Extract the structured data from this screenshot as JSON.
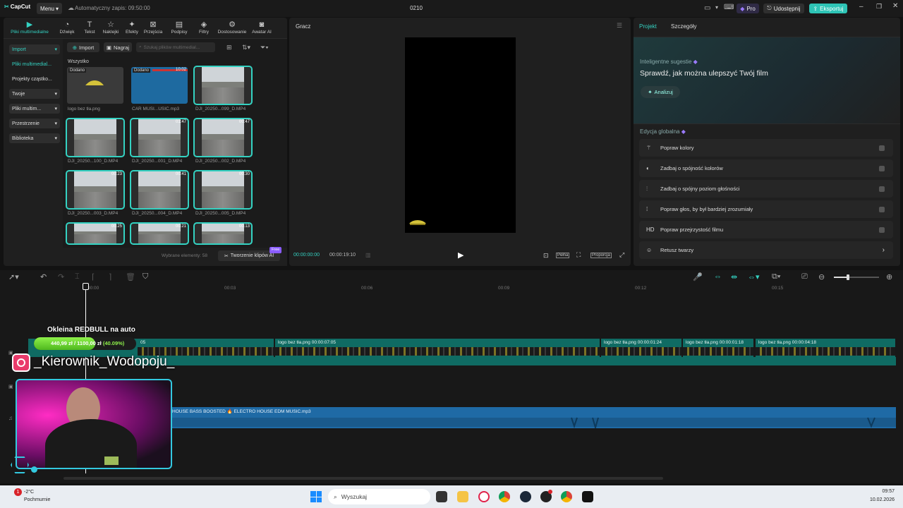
{
  "titlebar": {
    "app_name": "CapCut",
    "menu_label": "Menu",
    "autosave": "Automatyczny zapis: 09:50:00",
    "project_name": "0210",
    "pro_label": "Pro",
    "share_label": "Udostępnij",
    "export_label": "Eksportuj"
  },
  "toolbar": [
    {
      "label": "Pliki multimedialne",
      "icon": "media-icon"
    },
    {
      "label": "Dźwięk",
      "icon": "audio-icon"
    },
    {
      "label": "Tekst",
      "icon": "text-icon"
    },
    {
      "label": "Naklejki",
      "icon": "sticker-icon"
    },
    {
      "label": "Efekty",
      "icon": "effects-icon"
    },
    {
      "label": "Przejścia",
      "icon": "transition-icon"
    },
    {
      "label": "Podpisy",
      "icon": "captions-icon"
    },
    {
      "label": "Filtry",
      "icon": "filters-icon"
    },
    {
      "label": "Dostosowanie",
      "icon": "adjust-icon"
    },
    {
      "label": "Awatar AI",
      "icon": "avatar-icon"
    }
  ],
  "sidebar": [
    {
      "label": "Import"
    },
    {
      "label": "Pliki multimedial..."
    },
    {
      "label": "Projekty cząstko..."
    },
    {
      "label": "Twoje"
    },
    {
      "label": "Pliki multim..."
    },
    {
      "label": "Przestrzenie"
    },
    {
      "label": "Biblioteka"
    }
  ],
  "media": {
    "import_label": "Import",
    "record_label": "Nagraj",
    "search_placeholder": "Szukaj plików multimedial...",
    "all_label": "Wszystko",
    "added_badge": "Dodano",
    "items": [
      {
        "name": "logo bez tła.png",
        "dur": ""
      },
      {
        "name": "CAR MUSI...USIC.mp3",
        "dur": "10:02"
      },
      {
        "name": "DJI_20250...099_D.MP4",
        "dur": ""
      },
      {
        "name": "DJI_20250...100_D.MP4",
        "dur": ""
      },
      {
        "name": "DJI_20250...001_D.MP4",
        "dur": "01:47"
      },
      {
        "name": "DJI_20250...002_D.MP4",
        "dur": "00:47"
      },
      {
        "name": "DJI_20250...003_D.MP4",
        "dur": "00:23"
      },
      {
        "name": "DJI_20250...004_D.MP4",
        "dur": "00:41"
      },
      {
        "name": "DJI_20250...005_D.MP4",
        "dur": "00:30"
      },
      {
        "name": "",
        "dur": "00:25"
      },
      {
        "name": "",
        "dur": "00:21"
      },
      {
        "name": "",
        "dur": "00:13"
      }
    ],
    "selected_count": "Wybrane elementy: 58",
    "ai_clips_label": "Tworzenie klipów AI",
    "free_badge": "Free"
  },
  "player": {
    "title": "Gracz",
    "time_current": "00:00:00:00",
    "time_total": "00:00:19:10",
    "full_label": "Pełna",
    "ratio_label": "Proporcja"
  },
  "right": {
    "tab_project": "Projekt",
    "tab_details": "Szczegóły",
    "suggest_title": "Inteligentne sugestie",
    "suggest_heading": "Sprawdź, jak można ulepszyć Twój film",
    "analyze_label": "Analizuj",
    "global_title": "Edycja globalna",
    "rows": [
      {
        "label": "Popraw kolory",
        "icon": "wand-icon"
      },
      {
        "label": "Zadbaj o spójność kolorów",
        "icon": "color-match-icon"
      },
      {
        "label": "Zadbaj o spójny poziom głośności",
        "icon": "volume-levels-icon"
      },
      {
        "label": "Popraw głos, by był bardziej zrozumiały",
        "icon": "voice-icon"
      },
      {
        "label": "Popraw przejrzystość filmu",
        "icon": "hd-icon"
      },
      {
        "label": "Retusz twarzy",
        "icon": "face-retouch-icon"
      }
    ]
  },
  "timeline": {
    "ruler": [
      "00:00",
      "00:03",
      "00:06",
      "00:09",
      "00:12",
      "00:15"
    ],
    "video_clips": [
      {
        "label": "05"
      },
      {
        "label": "logo bez tła.png  00:00:07:05"
      },
      {
        "label": "logo bez tła.png  00:00:01:24"
      },
      {
        "label": "logo bez tła.png  00:00:01:18"
      },
      {
        "label": "logo bez tła.png  00:00:04:18"
      }
    ],
    "audio_label": "HOUSE BASS BOOSTED 🔥 ELECTRO HOUSE EDM MUSIC.mp3"
  },
  "overlay": {
    "goal_title": "Okleina REDBULL na auto",
    "goal_current": "440,99 zł",
    "goal_sep": "/",
    "goal_target": "1100,00 zł",
    "goal_percent": "(40.09%)",
    "goal_fraction": 0.4009,
    "instagram": "_Kierownik_Wodopoju_"
  },
  "taskbar": {
    "weather_temp": "-2°C",
    "weather_desc": "Pochmurnie",
    "weather_badge": "1",
    "search_label": "Wyszukaj",
    "time": "09:57",
    "date": "10.02.2026"
  },
  "colors": {
    "accent": "#34d2c2",
    "video_track": "#0f6b63",
    "audio_track": "#1f6aa5",
    "pro": "#7b5cff"
  }
}
